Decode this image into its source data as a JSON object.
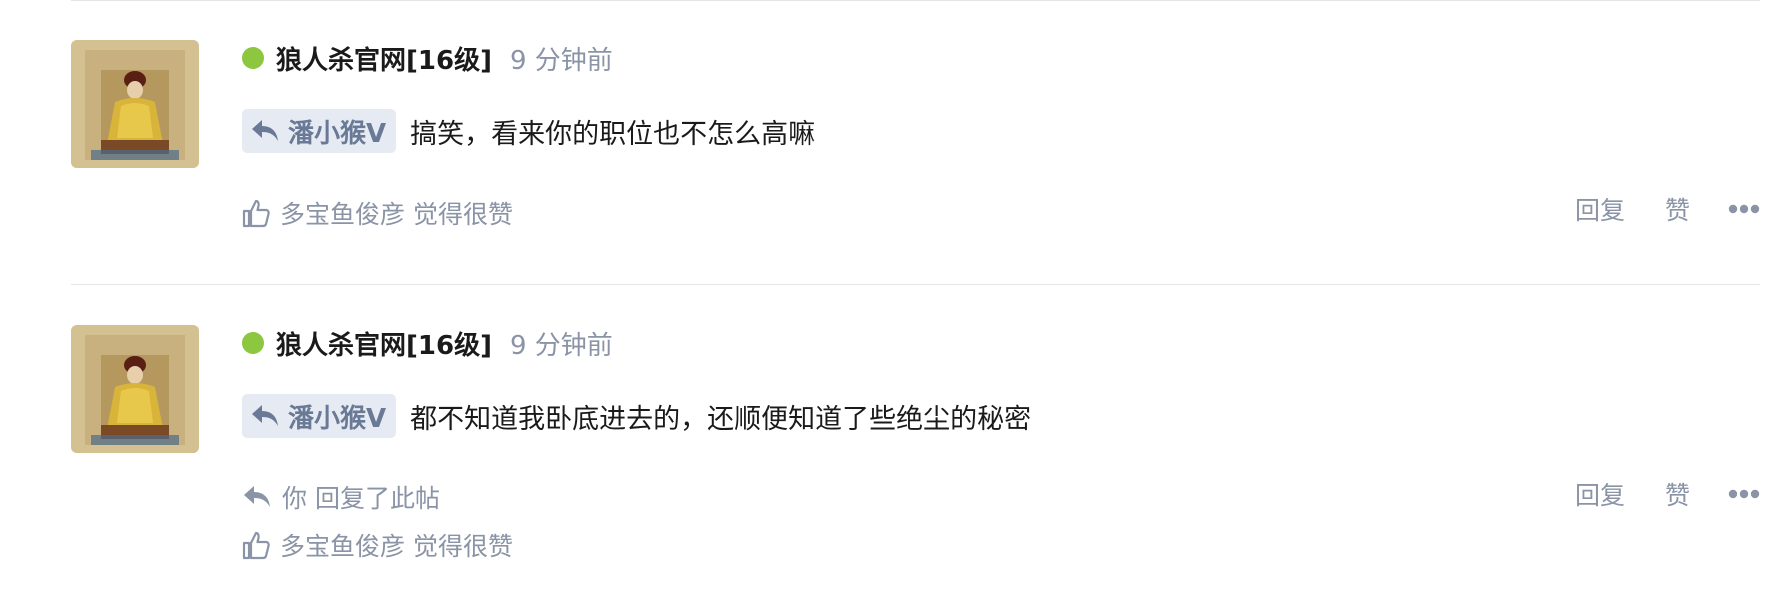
{
  "colors": {
    "online": "#8dc63f",
    "muted": "#8a94a6",
    "tag_bg": "#e6ebf3",
    "tag_text": "#6a7a96"
  },
  "comments": [
    {
      "avatar_icon": "emperor-portrait-avatar",
      "username": "狼人杀官网[16级]",
      "time": "9 分钟前",
      "reply_to": "潘小猴V",
      "content": "搞笑，看来你的职位也不怎么高嘛",
      "replied_note": null,
      "liked_by": "多宝鱼俊彦",
      "liked_suffix": "觉得很赞",
      "actions": {
        "reply": "回复",
        "like": "赞",
        "more_icon": "more-dots-icon"
      }
    },
    {
      "avatar_icon": "emperor-portrait-avatar",
      "username": "狼人杀官网[16级]",
      "time": "9 分钟前",
      "reply_to": "潘小猴V",
      "content": "都不知道我卧底进去的，还顺便知道了些绝尘的秘密",
      "replied_note": {
        "who": "你",
        "text": "回复了此帖"
      },
      "liked_by": "多宝鱼俊彦",
      "liked_suffix": "觉得很赞",
      "actions": {
        "reply": "回复",
        "like": "赞",
        "more_icon": "more-dots-icon"
      }
    }
  ]
}
